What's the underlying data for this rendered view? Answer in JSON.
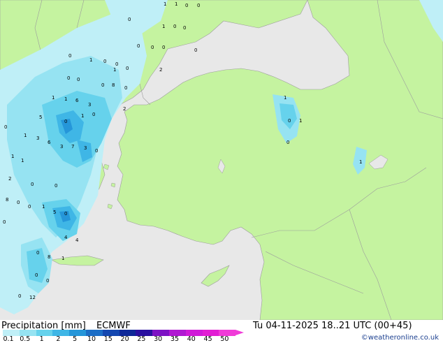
{
  "title": "Precipitation [mm]",
  "model": "ECMWF",
  "datetime": "Tu 04-11-2025 18..21 UTC (00+45)",
  "credit": "©weatheronline.co.uk",
  "colors": {
    "land": "#c5f3a0",
    "sea": "#e8e8e8",
    "border": "#9c9c9c"
  },
  "scale": [
    {
      "label": "0.1",
      "color": "#bfeff7"
    },
    {
      "label": "0.5",
      "color": "#96e3f2"
    },
    {
      "label": "1",
      "color": "#66d2ec"
    },
    {
      "label": "2",
      "color": "#3fb6e6"
    },
    {
      "label": "5",
      "color": "#2596d9"
    },
    {
      "label": "10",
      "color": "#1c6ec6"
    },
    {
      "label": "15",
      "color": "#1447b0"
    },
    {
      "label": "20",
      "color": "#0e2898"
    },
    {
      "label": "25",
      "color": "#2a10a0"
    },
    {
      "label": "30",
      "color": "#7d12c4"
    },
    {
      "label": "35",
      "color": "#b018d2"
    },
    {
      "label": "40",
      "color": "#d01ad8"
    },
    {
      "label": "45",
      "color": "#e21ed4"
    },
    {
      "label": "50",
      "color": "#f03cd8"
    }
  ],
  "values": [
    "1",
    "1",
    "0",
    "0",
    "0",
    "1",
    "0",
    "0",
    "0",
    "0",
    "0",
    "0",
    "0",
    "1",
    "0",
    "0",
    "2",
    "1",
    "0",
    "0",
    "0",
    "0",
    "8",
    "0",
    "1",
    "1",
    "6",
    "3",
    "2",
    "5",
    "0",
    "1",
    "0",
    "1",
    "0",
    "1",
    "0",
    "7",
    "3",
    "0",
    "1",
    "0",
    "1",
    "3",
    "6",
    "3",
    "1",
    "2",
    "8",
    "0",
    "0",
    "1",
    "0",
    "0",
    "5",
    "4",
    "4",
    "0",
    "0",
    "8",
    "1",
    "0",
    "0",
    "0",
    "12",
    "0",
    "1"
  ]
}
